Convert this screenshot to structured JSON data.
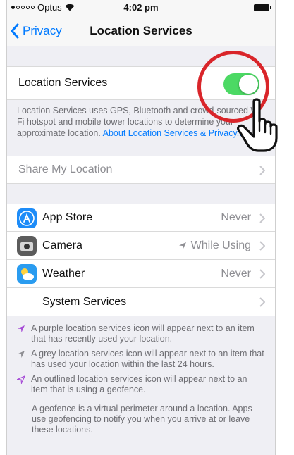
{
  "status_bar": {
    "carrier": "Optus",
    "time": "4:02 pm"
  },
  "nav": {
    "back_label": "Privacy",
    "title": "Location Services"
  },
  "location_services": {
    "label": "Location Services",
    "enabled": true,
    "description": "Location Services uses GPS, Bluetooth and crowd-sourced Wi-Fi hotspot and mobile tower locations to determine your approximate location.",
    "link": "About Location Services & Privacy..."
  },
  "share_my_location": {
    "label": "Share My Location"
  },
  "apps": [
    {
      "name": "App Store",
      "value": "Never",
      "icon": "app-store-icon",
      "color": "#1d8cf8"
    },
    {
      "name": "Camera",
      "value": "While Using",
      "icon": "camera-icon",
      "color": "#5c5c5c"
    },
    {
      "name": "Weather",
      "value": "Never",
      "icon": "weather-icon",
      "color": "#2a9cf0"
    }
  ],
  "system_services": {
    "label": "System Services"
  },
  "notes": [
    {
      "icon": "purple-arrow-icon",
      "color": "#a64bd6",
      "text": "A purple location services icon will appear next to an item that has recently used your location."
    },
    {
      "icon": "grey-arrow-icon",
      "color": "#8e8e93",
      "text": "A grey location services icon will appear next to an item that has used your location within the last 24 hours."
    },
    {
      "icon": "outlined-arrow-icon",
      "color": "#a64bd6",
      "text": "An outlined location services icon will appear next to an item that is using a geofence."
    }
  ],
  "geofence_note": "A geofence is a virtual perimeter around a location. Apps use geofencing to notify you when you arrive at or leave these locations.",
  "colors": {
    "accent": "#007aff",
    "toggle_on": "#4cd964",
    "highlight_ring": "#d9252a"
  }
}
